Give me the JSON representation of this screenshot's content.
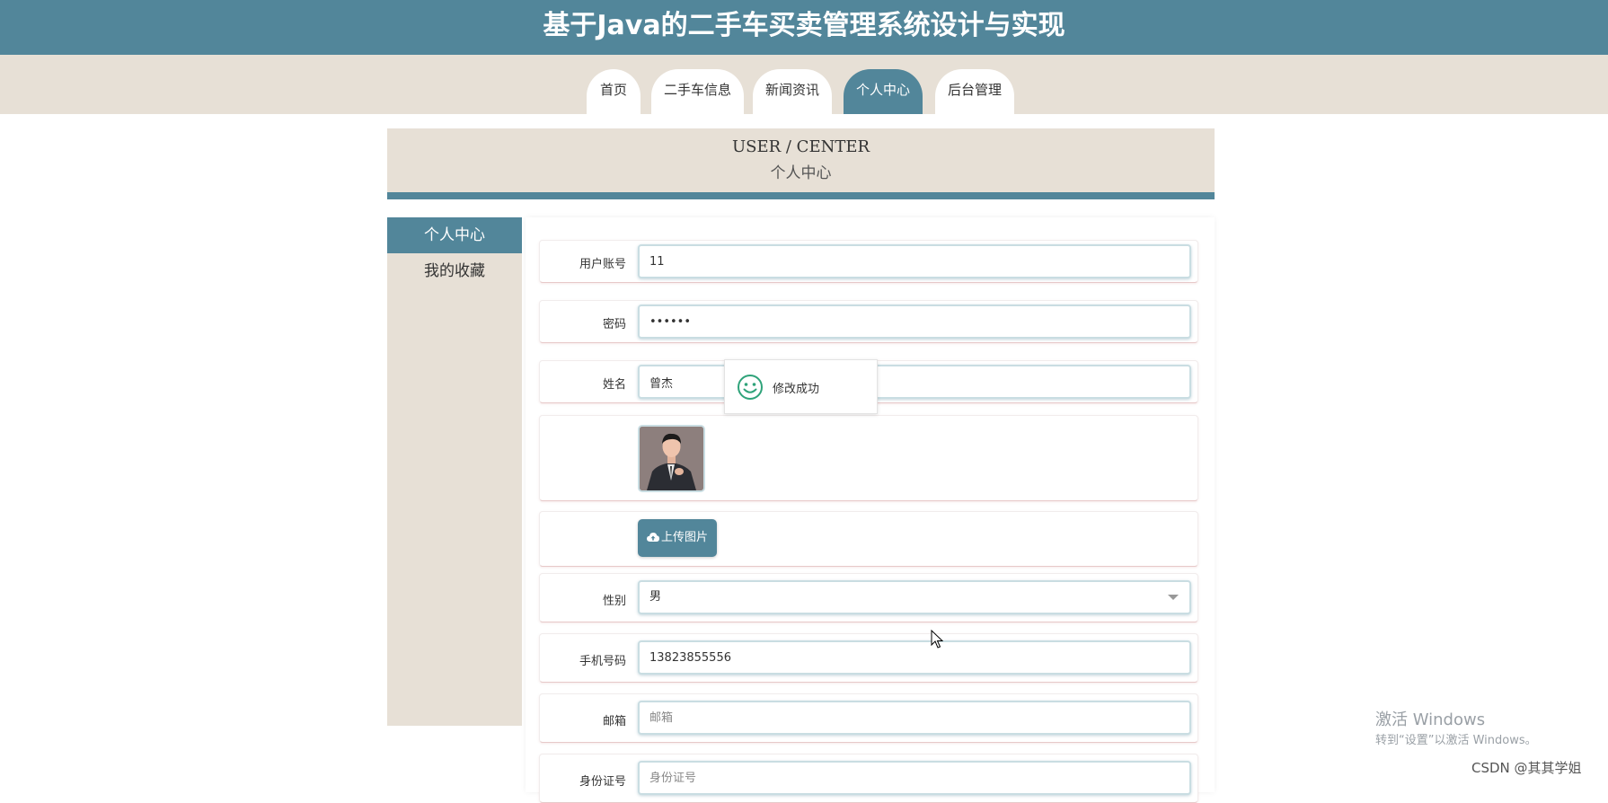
{
  "app": {
    "title": "基于Java的二手车买卖管理系统设计与实现"
  },
  "nav": {
    "tabs": [
      {
        "label": "首页"
      },
      {
        "label": "二手车信息"
      },
      {
        "label": "新闻资讯"
      },
      {
        "label": "个人中心",
        "active": true
      },
      {
        "label": "后台管理"
      }
    ]
  },
  "header": {
    "en": "USER / CENTER",
    "zh": "个人中心"
  },
  "sidebar": {
    "items": [
      {
        "label": "个人中心",
        "active": true
      },
      {
        "label": "我的收藏"
      }
    ]
  },
  "form": {
    "account": {
      "label": "用户账号",
      "value": "11"
    },
    "password": {
      "label": "密码",
      "value": "••••••"
    },
    "name": {
      "label": "姓名",
      "value": "曾杰"
    },
    "upload_label": "上传图片",
    "gender": {
      "label": "性别",
      "value": "男"
    },
    "phone": {
      "label": "手机号码",
      "value": "13823855556"
    },
    "email": {
      "label": "邮箱",
      "placeholder": "邮箱"
    },
    "idcard": {
      "label": "身份证号",
      "placeholder": "身份证号"
    }
  },
  "toast": {
    "message": "修改成功"
  },
  "overlay": {
    "activate_title": "激活 Windows",
    "activate_sub": "转到“设置”以激活 Windows。",
    "csdn": "CSDN @其其学姐"
  },
  "colors": {
    "primary": "#52869a",
    "beige": "#e7e0d6"
  }
}
